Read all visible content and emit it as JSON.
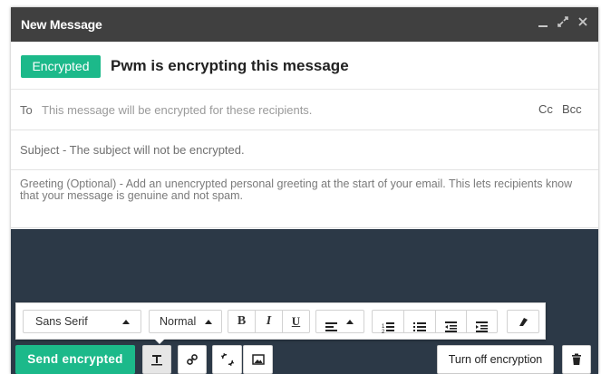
{
  "window": {
    "title": "New Message",
    "minimize_icon": "minimize-icon",
    "popout_icon": "expand-icon",
    "close_icon": "close-icon"
  },
  "encryption": {
    "badge": "Encrypted",
    "title": "Pwm is encrypting this message",
    "badge_color": "#1cb98a"
  },
  "to": {
    "label": "To",
    "placeholder": "This message will be encrypted for these recipients.",
    "cc": "Cc",
    "bcc": "Bcc"
  },
  "subject": {
    "placeholder": "Subject - The subject will not be encrypted."
  },
  "greeting": {
    "placeholder": "Greeting (Optional) - Add an unencrypted personal greeting at the start of your email. This lets recipients know that your message is genuine and not spam."
  },
  "body": {
    "background": "#2c3947"
  },
  "formatting": {
    "font_family": "Sans Serif",
    "font_size": "Normal",
    "bold": "B",
    "italic": "I",
    "underline": "U",
    "icons": [
      "align-icon",
      "numbered-list-icon",
      "bulleted-list-icon",
      "indent-less-icon",
      "indent-more-icon",
      "remove-formatting-icon"
    ]
  },
  "bottom": {
    "send_label": "Send encrypted",
    "formatting_toggle_icon": "text-format-icon",
    "link_icon": "link-icon",
    "unlink_icon": "unlink-icon",
    "image_icon": "image-icon",
    "turn_off_label": "Turn off encryption",
    "trash_icon": "trash-icon"
  }
}
